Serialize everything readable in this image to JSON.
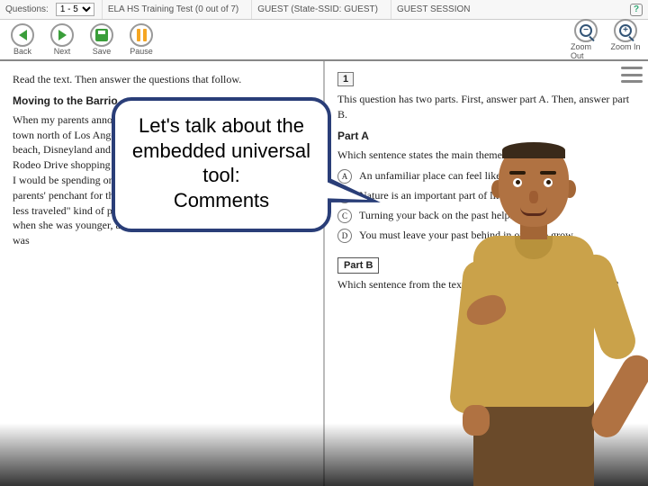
{
  "topbar": {
    "questions_label": "Questions:",
    "questions_value": "1 - 5",
    "test_title": "ELA HS Training Test (0 out of 7)",
    "guest_info": "GUEST (State-SSID: GUEST)",
    "session": "GUEST SESSION",
    "help": "?"
  },
  "toolbar": {
    "back": "Back",
    "next": "Next",
    "save": "Save",
    "pause": "Pause",
    "zoom_out": "Zoom Out",
    "zoom_in": "Zoom In"
  },
  "left": {
    "intro": "Read the text. Then answer the questions that follow.",
    "title": "Moving to the Barrio",
    "body": "When my parents announced we'd be moving out to California, to a town north of Los Angeles, my thoughts immediately went to the beach, Disneyland and Hollywood, glitz and glamour. I imagined a Rodeo Drive shopping spree to pick out a bikini for the endless days I would be spending on the beach. However, I'd forgotten about my parents' penchant for the unconventional; they're definitely \"the road less traveled\" kind of people. Mom had a gopher snake for a pet when she was younger, and Dad was never happier than when he was"
  },
  "right": {
    "qnum": "1",
    "stem": "This question has two parts. First, answer part A. Then, answer part B.",
    "partA_label": "Part A",
    "partA_q": "Which sentence states the main theme of the text?",
    "opts": {
      "a": "An unfamiliar place can feel like home.",
      "b": "Nature is an important part of life.",
      "c": "Turning your back on the past helps you live.",
      "d": "You must leave your past behind in order to grow."
    },
    "partB_label": "Part B",
    "partB_q": "Which sentence from the text best supports the answer in part A?"
  },
  "bubble": {
    "line1": "Let's talk about the",
    "line2": "embedded universal",
    "line3": "tool:",
    "line4": "Comments"
  }
}
